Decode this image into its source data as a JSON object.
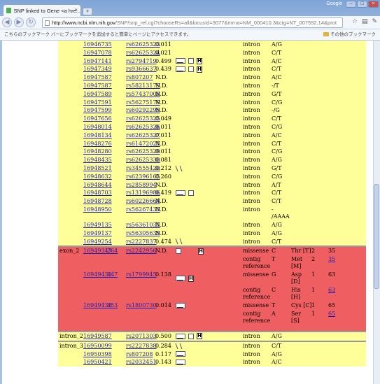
{
  "browser": {
    "tab_title": "SNP linked to Gene <a hre...",
    "close_glyph": "×",
    "new_tab_glyph": "+",
    "google_label": "Google",
    "url_host": "http://www.ncbi.nlm.nih.gov",
    "url_rest": "/SNP/snp_ref.cgi?chooseRs=all&locusId=3077&mrna=NM_000410.3&ctg=NT_007592.14&prot",
    "bookmark_message": "こちらのブックマーク バーにブックマークを追加すると簡単にページにアクセスできます。",
    "other_bookmarks": "その他のブックマーク",
    "back_glyph": "◀",
    "forward_glyph": "▶",
    "reload_glyph": "↻",
    "star_glyph": "☆",
    "page_glyph": "▤",
    "wrench_glyph": "✎"
  },
  "rows": [
    {
      "bg": "y",
      "region": "",
      "contig": "16946735",
      "mrna": "",
      "rs": "rs62625323",
      "het": "0.011",
      "icons": "",
      "func": "intron",
      "allele": "A/G",
      "prot": "",
      "frame": "",
      "pos": ""
    },
    {
      "bg": "y",
      "region": "",
      "contig": "16947078",
      "mrna": "",
      "rs": "rs62625324",
      "het": "0.021",
      "icons": "",
      "func": "intron",
      "allele": "C/T",
      "prot": "",
      "frame": "",
      "pos": ""
    },
    {
      "bg": "y",
      "region": "",
      "contig": "16947141",
      "mrna": "",
      "rs": "rs2794719",
      "het": "0.499",
      "icons": "a3h",
      "func": "intron",
      "allele": "A/C",
      "prot": "",
      "frame": "",
      "pos": ""
    },
    {
      "bg": "y",
      "region": "",
      "contig": "16947349",
      "mrna": "",
      "rs": "rs9366637",
      "het": "0.439",
      "icons": "a3h",
      "func": "intron",
      "allele": "C/T",
      "prot": "",
      "frame": "",
      "pos": ""
    },
    {
      "bg": "y",
      "region": "",
      "contig": "16947587",
      "mrna": "",
      "rs": "rs807207",
      "het": "N.D.",
      "icons": "",
      "func": "intron",
      "allele": "A/C",
      "prot": "",
      "frame": "",
      "pos": ""
    },
    {
      "bg": "y",
      "region": "",
      "contig": "16947587",
      "mrna": "",
      "rs": "rs58213179",
      "het": "N.D.",
      "icons": "",
      "func": "intron",
      "allele": "-/T",
      "prot": "",
      "frame": "",
      "pos": ""
    },
    {
      "bg": "y",
      "region": "",
      "contig": "16947589",
      "mrna": "",
      "rs": "rs57437008",
      "het": "N.D.",
      "icons": "",
      "func": "intron",
      "allele": "G/T",
      "prot": "",
      "frame": "",
      "pos": ""
    },
    {
      "bg": "y",
      "region": "",
      "contig": "16947591",
      "mrna": "",
      "rs": "rs56275179",
      "het": "N.D.",
      "icons": "",
      "func": "intron",
      "allele": "C/G",
      "prot": "",
      "frame": "",
      "pos": ""
    },
    {
      "bg": "y",
      "region": "",
      "contig": "16947599",
      "mrna": "",
      "rs": "rs60292295",
      "het": "N.D.",
      "icons": "",
      "func": "intron",
      "allele": "-/G",
      "prot": "",
      "frame": "",
      "pos": ""
    },
    {
      "bg": "y",
      "region": "",
      "contig": "16947656",
      "mrna": "",
      "rs": "rs62625325",
      "het": "0.049",
      "icons": "",
      "func": "intron",
      "allele": "C/T",
      "prot": "",
      "frame": "",
      "pos": ""
    },
    {
      "bg": "y",
      "region": "",
      "contig": "16948014",
      "mrna": "",
      "rs": "rs62625326",
      "het": "0.011",
      "icons": "",
      "func": "intron",
      "allele": "C/G",
      "prot": "",
      "frame": "",
      "pos": ""
    },
    {
      "bg": "y",
      "region": "",
      "contig": "16948134",
      "mrna": "",
      "rs": "rs62625327",
      "het": "0.011",
      "icons": "",
      "func": "intron",
      "allele": "A/C",
      "prot": "",
      "frame": "",
      "pos": ""
    },
    {
      "bg": "y",
      "region": "",
      "contig": "16948276",
      "mrna": "",
      "rs": "rs61472021",
      "het": "N.D.",
      "icons": "",
      "func": "intron",
      "allele": "C/T",
      "prot": "",
      "frame": "",
      "pos": ""
    },
    {
      "bg": "y",
      "region": "",
      "contig": "16948280",
      "mrna": "",
      "rs": "rs62625329",
      "het": "0.011",
      "icons": "",
      "func": "intron",
      "allele": "C/G",
      "prot": "",
      "frame": "",
      "pos": ""
    },
    {
      "bg": "y",
      "region": "",
      "contig": "16948435",
      "mrna": "",
      "rs": "rs62625330",
      "het": "0.081",
      "icons": "",
      "func": "intron",
      "allele": "A/G",
      "prot": "",
      "frame": "",
      "pos": ""
    },
    {
      "bg": "y",
      "region": "",
      "contig": "16948521",
      "mrna": "",
      "rs": "rs34555420",
      "het": "0.212",
      "icons": "f",
      "func": "intron",
      "allele": "G/T",
      "prot": "",
      "frame": "",
      "pos": ""
    },
    {
      "bg": "y",
      "region": "",
      "contig": "16948632",
      "mrna": "",
      "rs": "rs62396165",
      "het": "0.260",
      "icons": "",
      "func": "intron",
      "allele": "C/G",
      "prot": "",
      "frame": "",
      "pos": ""
    },
    {
      "bg": "y",
      "region": "",
      "contig": "16948644",
      "mrna": "",
      "rs": "rs2858994",
      "het": "N.D.",
      "icons": "",
      "func": "intron",
      "allele": "A/T",
      "prot": "",
      "frame": "",
      "pos": ""
    },
    {
      "bg": "y",
      "region": "",
      "contig": "16948703",
      "mrna": "",
      "rs": "rs13196986",
      "het": "0.419",
      "icons": "a3",
      "func": "intron",
      "allele": "C/T",
      "prot": "",
      "frame": "",
      "pos": ""
    },
    {
      "bg": "y",
      "region": "",
      "contig": "16948728",
      "mrna": "",
      "rs": "rs60226664",
      "het": "N.D.",
      "icons": "",
      "func": "intron",
      "allele": "C/T",
      "prot": "",
      "frame": "",
      "pos": ""
    },
    {
      "bg": "y",
      "tall": true,
      "region": "",
      "contig": "16948950",
      "mrna": "",
      "rs": "rs56267433",
      "het": "N.D.",
      "icons": "",
      "func": "intron",
      "allele": "- /AAAA",
      "prot": "",
      "frame": "",
      "pos": ""
    },
    {
      "bg": "y",
      "region": "",
      "contig": "16949135",
      "mrna": "",
      "rs": "rs56361031",
      "het": "N.D.",
      "icons": "",
      "func": "intron",
      "allele": "A/G",
      "prot": "",
      "frame": "",
      "pos": ""
    },
    {
      "bg": "y",
      "region": "",
      "contig": "16949137",
      "mrna": "",
      "rs": "rs56305635",
      "het": "N.D.",
      "icons": "",
      "func": "intron",
      "allele": "A/G",
      "prot": "",
      "frame": "",
      "pos": ""
    },
    {
      "bg": "y",
      "region": "",
      "contig": "16949254",
      "mrna": "",
      "rs": "rs2227837",
      "het": "0.474",
      "icons": "f",
      "func": "intron",
      "allele": "C/T",
      "prot": "",
      "frame": "",
      "pos": ""
    },
    {
      "sep": true
    },
    {
      "bg": "r",
      "region": "exon_2",
      "contig": "16949347",
      "mrna": "264",
      "rs": "rs2242956",
      "het": "N.D.",
      "icons": "s h",
      "func": "missense",
      "allele": "C",
      "prot": "Thr [T]",
      "frame": "2",
      "pos": "35"
    },
    {
      "bg": "r",
      "tall": true,
      "region": "",
      "contig": "",
      "mrna": "",
      "rs": "",
      "het": "",
      "icons": "",
      "func": "contig reference",
      "allele": "T",
      "prot": "Met [M]",
      "frame": "2",
      "pos": "35",
      "poslink": true
    },
    {
      "bg": "r",
      "tall": true,
      "region": "",
      "contig": "16949430",
      "mrna": "347",
      "rs": "rs1799945",
      "het": "0.138",
      "icons": "ah",
      "func": "missense",
      "allele": "G",
      "prot": "Asp [D]",
      "frame": "1",
      "pos": "63"
    },
    {
      "bg": "r",
      "tall": true,
      "region": "",
      "contig": "",
      "mrna": "",
      "rs": "",
      "het": "",
      "icons": "",
      "func": "contig reference",
      "allele": "C",
      "prot": "His [H]",
      "frame": "1",
      "pos": "63",
      "poslink": true
    },
    {
      "bg": "r",
      "region": "",
      "contig": "16949436",
      "mrna": "353",
      "rs": "rs1800730",
      "het": "0.014",
      "icons": "a",
      "func": "missense",
      "allele": "T",
      "prot": "Cys [C]",
      "frame": "1",
      "pos": "65"
    },
    {
      "bg": "r",
      "tall": true,
      "region": "",
      "contig": "",
      "mrna": "",
      "rs": "",
      "het": "",
      "icons": "",
      "func": "contig reference",
      "allele": "A",
      "prot": "Ser [S]",
      "frame": "1",
      "pos": "65",
      "poslink": true
    },
    {
      "gap": true
    },
    {
      "sep": true
    },
    {
      "bg": "y",
      "region": "intron_2",
      "contig": "16949587",
      "mrna": "",
      "rs": "rs2071303",
      "het": "0.500",
      "icons": "a3h",
      "func": "intron",
      "allele": "A/G",
      "prot": "",
      "frame": "",
      "pos": ""
    },
    {
      "sep": true
    },
    {
      "bg": "y",
      "region": "intron_3",
      "contig": "16950099",
      "mrna": "",
      "rs": "rs2227838",
      "het": "0.284",
      "icons": "f",
      "func": "intron",
      "allele": "C/T",
      "prot": "",
      "frame": "",
      "pos": ""
    },
    {
      "bg": "y",
      "region": "",
      "contig": "16950398",
      "mrna": "",
      "rs": "rs807208",
      "het": "0.117",
      "icons": "a",
      "func": "intron",
      "allele": "A/G",
      "prot": "",
      "frame": "",
      "pos": ""
    },
    {
      "bg": "y",
      "region": "",
      "contig": "16950421",
      "mrna": "",
      "rs": "rs2032451",
      "het": "0.143",
      "icons": "a",
      "func": "intron",
      "allele": "A/C",
      "prot": "",
      "frame": "",
      "pos": ""
    }
  ]
}
